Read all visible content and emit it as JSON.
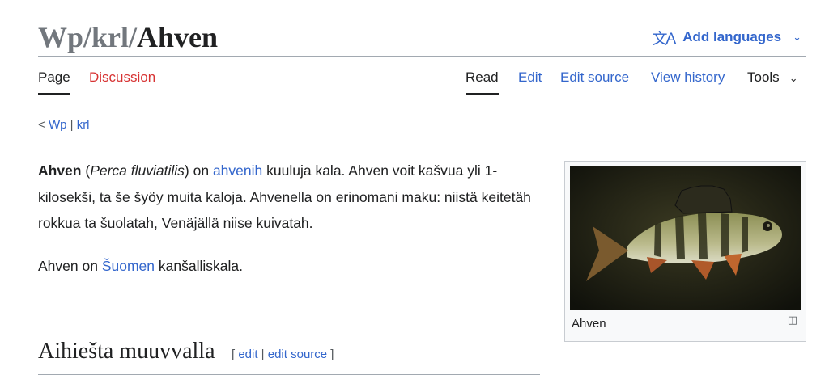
{
  "title": {
    "prefix": "Wp/krl/",
    "name": "Ahven"
  },
  "language_button": {
    "label": "Add languages",
    "icon": "translate-icon"
  },
  "tabs": {
    "page": "Page",
    "discussion": "Discussion",
    "read": "Read",
    "edit": "Edit",
    "edit_source": "Edit source",
    "view_history": "View history",
    "tools": "Tools"
  },
  "subpages": {
    "lt": "<",
    "wp": "Wp",
    "sep": "|",
    "krl": "krl"
  },
  "article": {
    "p1": {
      "bold": "Ahven",
      "paren_open": "(",
      "italic": "Perca fluviatilis",
      "mid": ") on",
      "link": "ahvenih",
      "rest": "kuuluja kala. Ahven voit kašvua yli 1-kilosekši, ta še šyöy muita kaloja. Ahvenella on erinomani maku: niistä keitetäh rokkua ta šuolatah, Venäjällä niise kuivatah."
    },
    "p2": {
      "start": "Ahven on",
      "link": "Šuomen",
      "end": "kanšalliskala."
    }
  },
  "figure": {
    "caption": "Ahven",
    "enlarge_icon": "magnify-clip-icon"
  },
  "section": {
    "heading": "Aihiešta muuvvalla",
    "bracket_open": "[",
    "edit": "edit",
    "sep": "|",
    "edit_source": "edit source",
    "bracket_close": "]"
  },
  "colors": {
    "link": "#3366cc",
    "discussion_link": "#d73333",
    "text": "#202122",
    "border": "#a2a9b1"
  }
}
